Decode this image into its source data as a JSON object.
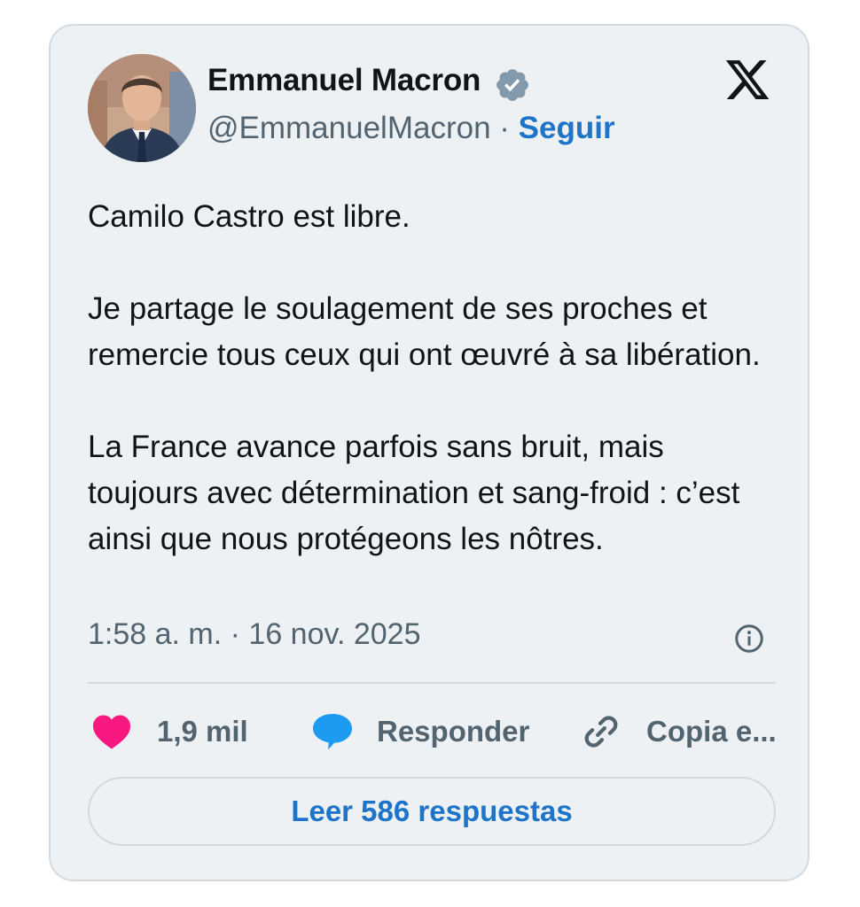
{
  "author": {
    "name": "Emmanuel Macron",
    "handle": "@EmmanuelMacron",
    "separator": "·",
    "follow_label": "Seguir"
  },
  "tweet": {
    "paragraphs": [
      "Camilo Castro est libre.",
      "Je partage le soulagement de ses proches et remercie tous ceux qui ont œuvré à sa libération.",
      "La France avance parfois sans bruit, mais toujours avec détermination et sang-froid : c’est ainsi que nous protégeons les nôtres."
    ],
    "timestamp": "1:58 a. m. · 16 nov. 2025"
  },
  "actions": {
    "likes": "1,9 mil",
    "reply_label": "Responder",
    "copy_label": "Copia e..."
  },
  "footer": {
    "read_replies_label": "Leer 586 respuestas"
  },
  "icons": {
    "verified": "verified-badge-icon",
    "brand": "x-logo-icon",
    "info": "info-icon",
    "like": "heart-icon",
    "reply": "speech-bubble-icon",
    "copy": "link-icon"
  },
  "colors": {
    "card_background": "#edf1f4",
    "accent_blue": "#1d74c9",
    "like_pink": "#f91880",
    "reply_blue": "#1d9bf0",
    "muted_text": "#536471",
    "verified_gray": "#829aab"
  }
}
